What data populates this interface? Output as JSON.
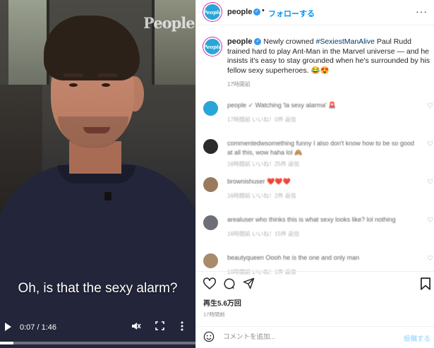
{
  "video": {
    "watermark": "People",
    "caption": "Oh, is that the sexy alarm?",
    "time": "0:07 / 1:46",
    "progress": 0.07,
    "play_icon": "play-icon",
    "mute_icon": "volume-muted-icon",
    "fullscreen_icon": "fullscreen-icon",
    "menu_icon": "more-vertical-icon"
  },
  "post": {
    "header": {
      "avatar_text": "People",
      "username": "people",
      "verified": "✓",
      "separator": "•",
      "follow_label": "フォローする",
      "more_label": "···"
    },
    "caption": {
      "username": "people",
      "text_before": " Newly crowned ",
      "hashtag": "#SexiestManAlive",
      "text_after": " Paul Rudd trained hard to play Ant-Man in the Marvel universe — and he insists it's easy to stay grounded when he's surrounded by his fellow sexy superheroes. 😂😍",
      "time": "17時間前"
    },
    "comments": [
      {
        "text": "people ✓ Watching 'la sexy alarma' 🚨",
        "meta": "17時間前  いいね！0件  返信",
        "avatar_color": "#2aa5d8"
      },
      {
        "text": "commentedwsomething funny I also don't know how to be so good at all this, wow haha lol 🙈",
        "meta": "16時間前  いいね！25件  返信",
        "avatar_color": "#2b2b2b"
      },
      {
        "text": "brownishuser ❤️❤️❤️",
        "meta": "16時間前  いいね！2件  返信",
        "avatar_color": "#9a7a5e"
      },
      {
        "text": "arealuser who thinks this is what sexy looks like? lol nothing",
        "meta": "16時間前  いいね！15件  返信",
        "avatar_color": "#6d6f78"
      },
      {
        "text": "beautyqueen Oooh he is the one and only man",
        "meta": "16時間前  いいね！1件  返信",
        "avatar_color": "#a88b6a"
      }
    ],
    "actions": {
      "likes": "再生5.6万回",
      "time": "17時間前"
    },
    "add_comment": {
      "placeholder": "コメントを追加...",
      "post_label": "投稿する"
    }
  },
  "colors": {
    "accent": "#0095f6",
    "hashtag": "#00376b",
    "muted": "#8e8e8e"
  }
}
